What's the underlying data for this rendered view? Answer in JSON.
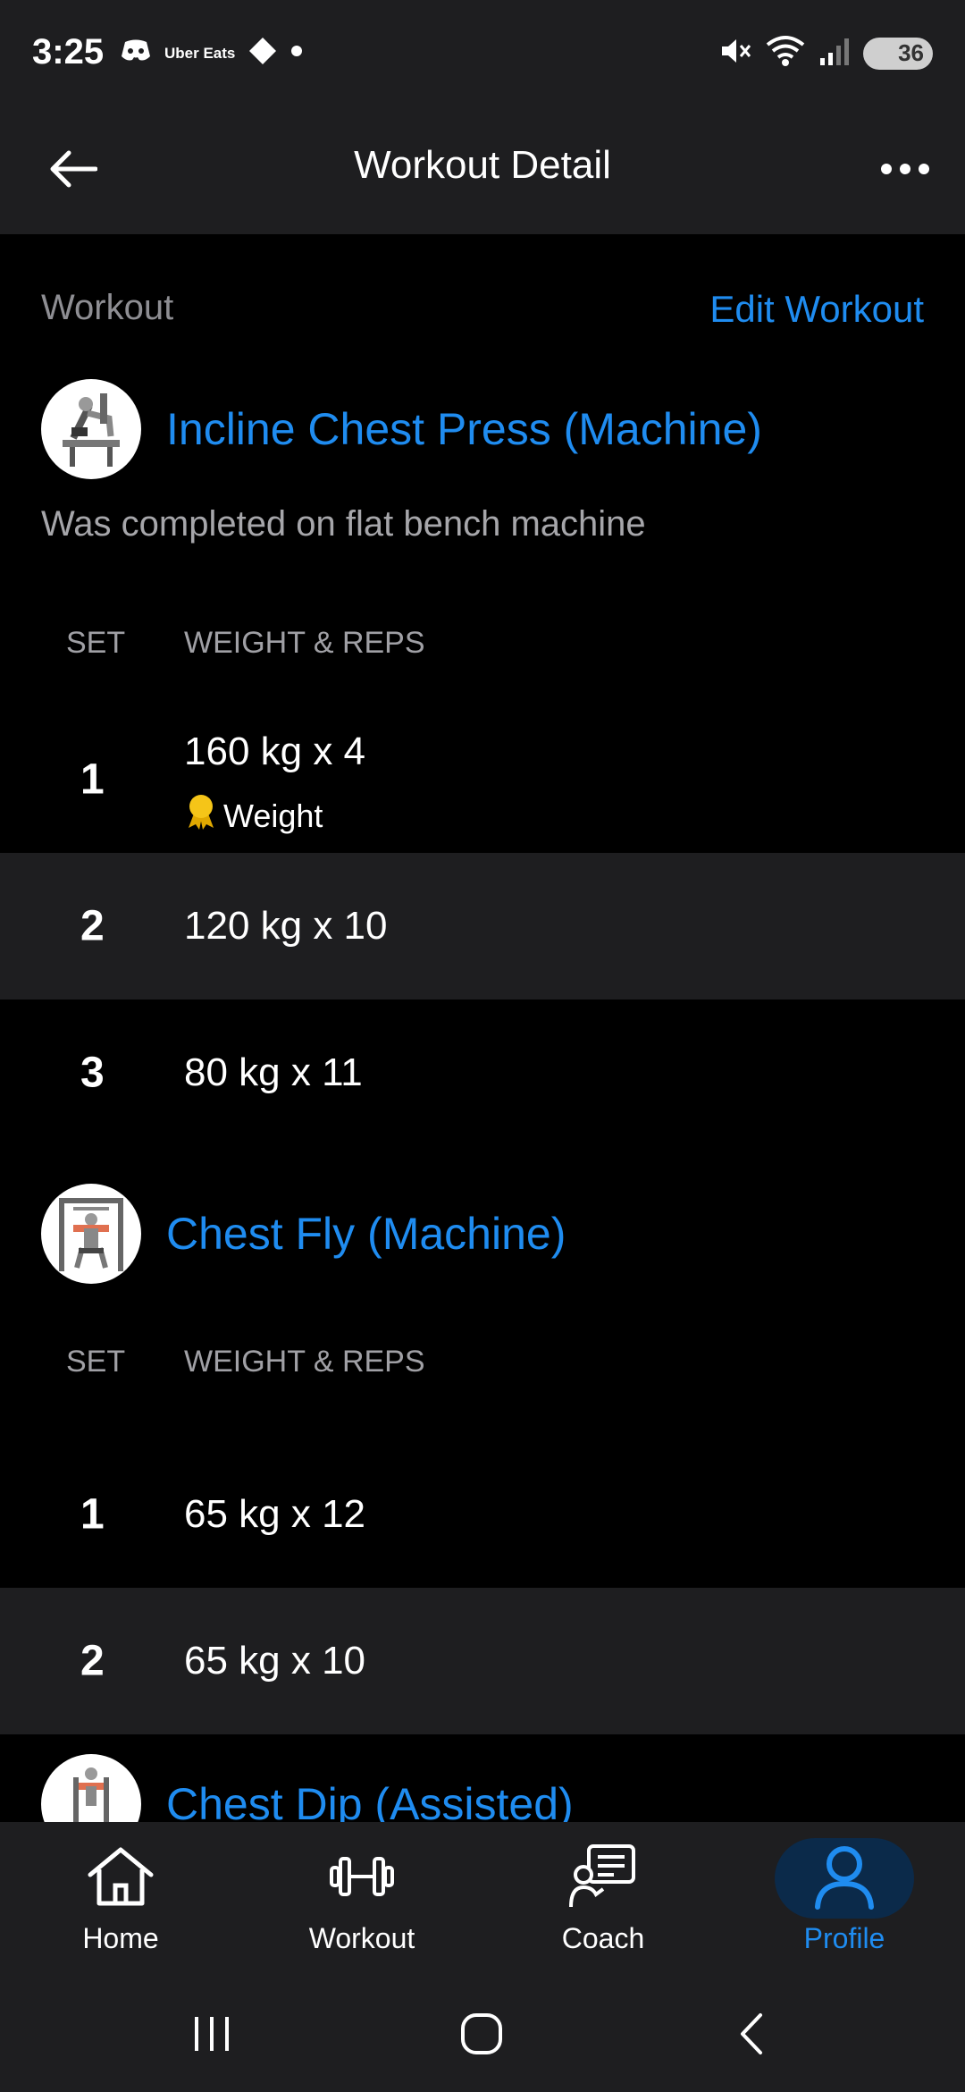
{
  "status_bar": {
    "time": "3:25",
    "app_badge": "Uber Eats",
    "battery": "36",
    "icons": [
      "discord-icon",
      "uber-eats-icon",
      "diamond-icon",
      "dot-icon",
      "mute-icon",
      "wifi-icon",
      "signal-icon",
      "battery-icon"
    ]
  },
  "app_bar": {
    "title": "Workout Detail",
    "back_icon": "arrow-left-icon",
    "more_icon": "more-horizontal-icon"
  },
  "workout": {
    "label": "Workout",
    "edit_label": "Edit Workout"
  },
  "exercises": [
    {
      "name": "Incline Chest Press (Machine)",
      "note": "Was completed on flat bench machine",
      "header_set": "SET",
      "header_weight_reps": "WEIGHT & REPS",
      "sets": [
        {
          "num": "1",
          "value": "160 kg x 4",
          "record": "Weight"
        },
        {
          "num": "2",
          "value": "120 kg x 10"
        },
        {
          "num": "3",
          "value": "80 kg x 11"
        }
      ]
    },
    {
      "name": "Chest Fly (Machine)",
      "header_set": "SET",
      "header_weight_reps": "WEIGHT & REPS",
      "sets": [
        {
          "num": "1",
          "value": "65 kg x 12"
        },
        {
          "num": "2",
          "value": "65 kg x 10"
        }
      ]
    },
    {
      "name": "Chest Dip (Assisted)"
    }
  ],
  "bottom_nav": {
    "items": [
      {
        "label": "Home",
        "icon": "home-icon"
      },
      {
        "label": "Workout",
        "icon": "dumbbell-icon"
      },
      {
        "label": "Coach",
        "icon": "coach-icon"
      },
      {
        "label": "Profile",
        "icon": "profile-icon",
        "active": true
      }
    ]
  },
  "colors": {
    "accent": "#1f8cf0",
    "background": "#000000",
    "surface": "#1e1e20",
    "muted_text": "#8e8e93",
    "medal": "#f5c518"
  }
}
